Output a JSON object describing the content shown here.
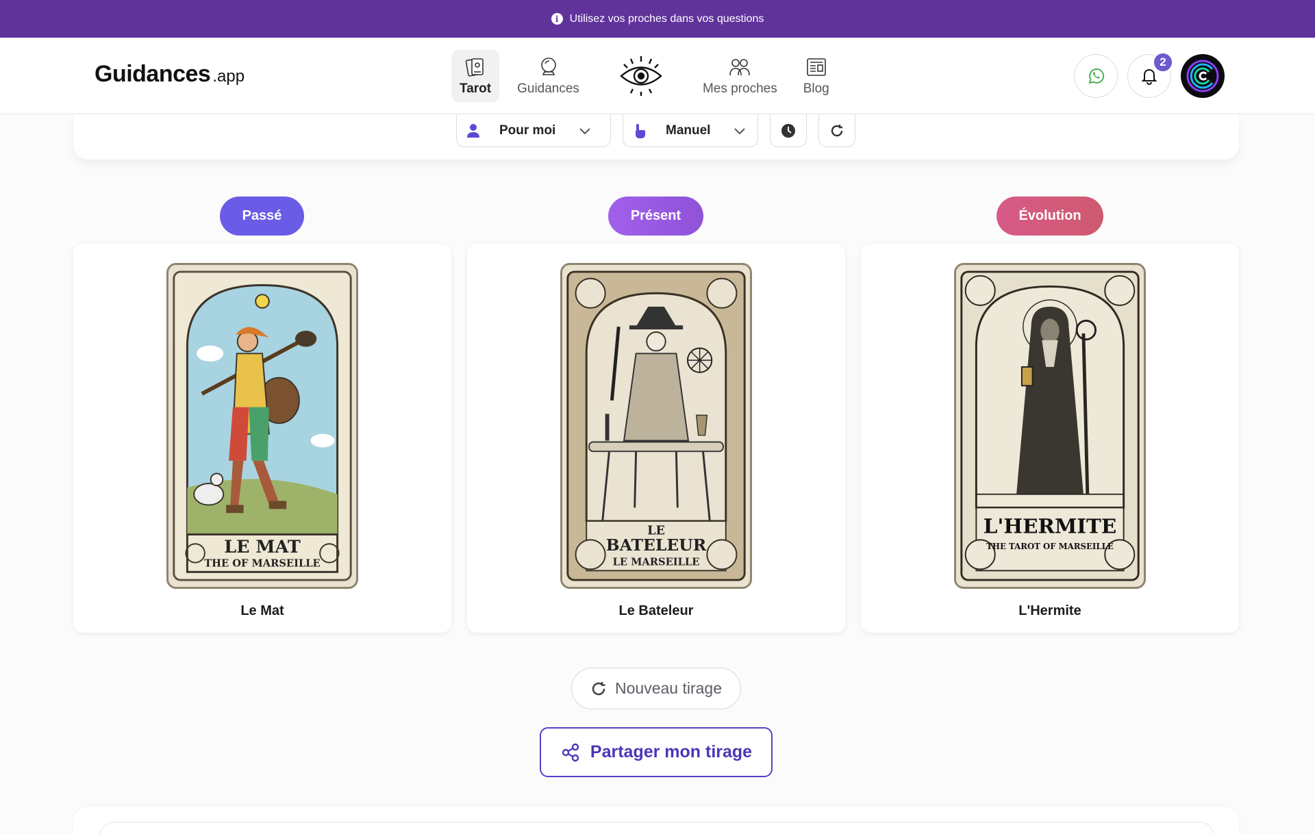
{
  "banner": {
    "text": "Utilisez vos proches dans vos questions",
    "icon": "info-icon"
  },
  "header": {
    "logo_main": "Guidances",
    "logo_suffix": ".app",
    "nav": [
      {
        "label": "Tarot",
        "icon": "tarot-cards-icon",
        "active": true
      },
      {
        "label": "Guidances",
        "icon": "crystal-ball-icon",
        "active": false
      },
      {
        "label": "",
        "icon": "eye-icon",
        "active": false
      },
      {
        "label": "Mes proches",
        "icon": "people-icon",
        "active": false
      },
      {
        "label": "Blog",
        "icon": "newspaper-icon",
        "active": false
      }
    ],
    "notifications_count": "2",
    "colors": {
      "whatsapp": "#4caf50",
      "accent": "#6a5acd"
    }
  },
  "controls": {
    "subject": "Pour moi",
    "mode": "Manuel"
  },
  "spread": {
    "positions": [
      {
        "label": "Passé",
        "card_name": "Le Mat",
        "card_title": "LE MAT",
        "card_subtitle": "THE OF MARSEILLE",
        "color": "#6b5ce7"
      },
      {
        "label": "Présent",
        "card_name": "Le Bateleur",
        "card_title": "BATELEUR",
        "card_pre": "LE",
        "card_subtitle": "LE MARSEILLE",
        "color": "#9b59e0"
      },
      {
        "label": "Évolution",
        "card_name": "L'Hermite",
        "card_title": "L'HERMITE",
        "card_subtitle": "THE TAROT OF MARSEILLE",
        "color": "#d45a80"
      }
    ]
  },
  "actions": {
    "new_draw": "Nouveau tirage",
    "share": "Partager mon tirage"
  }
}
